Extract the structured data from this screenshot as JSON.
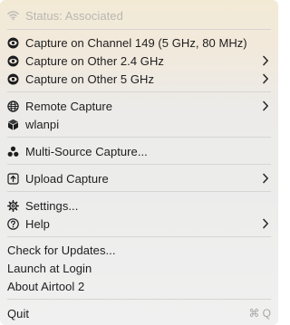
{
  "status": {
    "label": "Status: Associated"
  },
  "capture": {
    "channel_label": "Capture on Channel 149 (5 GHz, 80 MHz)",
    "other_24_label": "Capture on Other 2.4 GHz",
    "other_5_label": "Capture on Other 5 GHz"
  },
  "remote": {
    "remote_label": "Remote Capture",
    "wlanpi_label": "wlanpi"
  },
  "multi": {
    "label": "Multi-Source Capture..."
  },
  "upload": {
    "label": "Upload Capture"
  },
  "prefs": {
    "settings_label": "Settings...",
    "help_label": "Help"
  },
  "app": {
    "check_updates_label": "Check for Updates...",
    "launch_login_label": "Launch at Login",
    "about_label": "About Airtool 2"
  },
  "quit": {
    "label": "Quit",
    "shortcut": "⌘ Q"
  },
  "icons": {
    "status": "wifi-icon",
    "capture": "eye-icon",
    "remote": "globe-icon",
    "wlanpi": "cube-icon",
    "multi": "three-circles-icon",
    "upload": "upload-icon",
    "settings": "gear-icon",
    "help": "question-icon",
    "submenu": "chevron-right-icon"
  }
}
